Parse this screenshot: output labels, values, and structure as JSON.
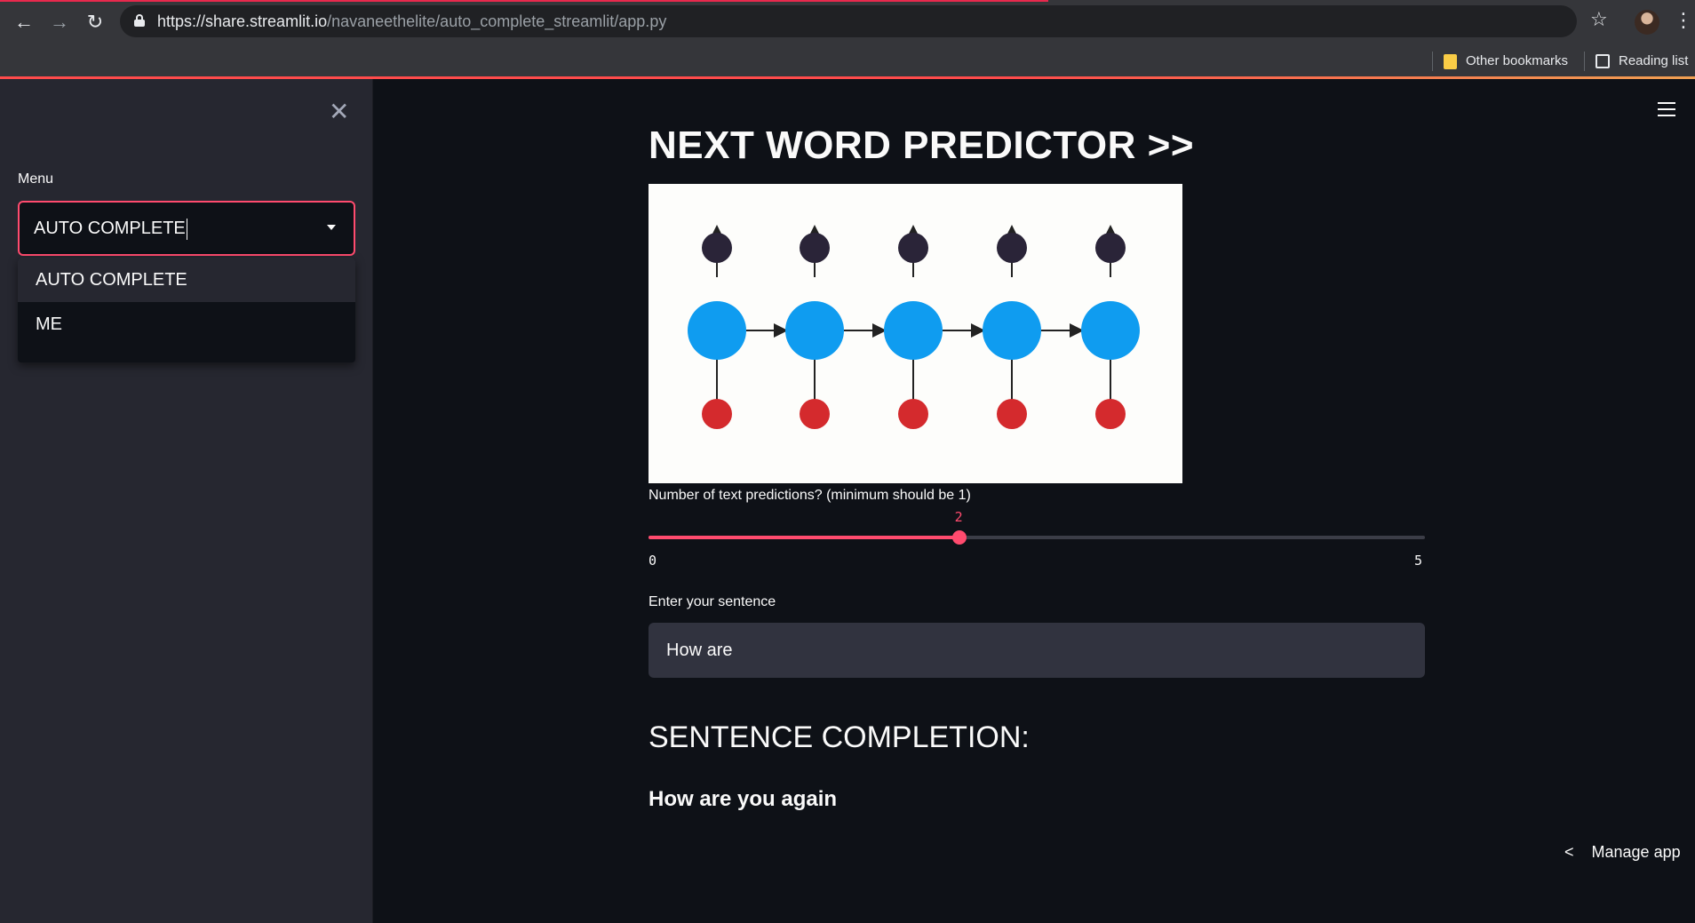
{
  "browser": {
    "url_host": "https://share.streamlit.io",
    "url_path": "/navaneethelite/auto_complete_streamlit/app.py",
    "bookmarks": [
      "Other bookmarks",
      "Reading list"
    ]
  },
  "sidebar": {
    "menu_label": "Menu",
    "select_value": "AUTO COMPLETE",
    "options": [
      "AUTO COMPLETE",
      "ME"
    ]
  },
  "main": {
    "title": "NEXT WORD PREDICTOR >>",
    "slider": {
      "label": "Number of text predictions? (minimum should be 1)",
      "min": 0,
      "max": 5,
      "value": 2,
      "min_label": "0",
      "max_label": "5",
      "value_label": "2"
    },
    "input": {
      "label": "Enter your sentence",
      "value": "How are"
    },
    "section_heading": "SENTENCE COMPLETION:",
    "result": "How are you again",
    "manage_app": "Manage app"
  },
  "colors": {
    "accent": "#ff4b6e",
    "node_blue": "#0f9cf0",
    "node_dark": "#2a2438",
    "node_red": "#d42a2d"
  }
}
